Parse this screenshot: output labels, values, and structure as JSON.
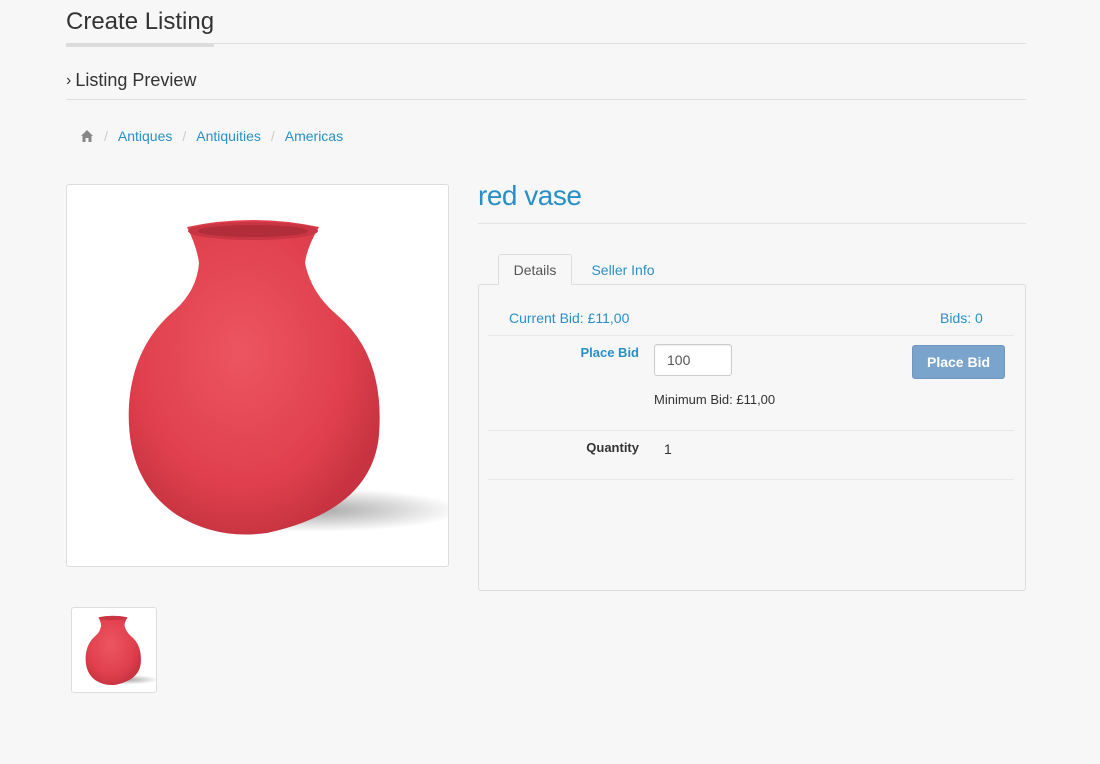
{
  "page": {
    "title": "Create Listing",
    "section_heading": "Listing Preview"
  },
  "breadcrumb": {
    "home_icon": "home-icon",
    "items": [
      "Antiques",
      "Antiquities",
      "Americas"
    ]
  },
  "listing": {
    "title": "red vase",
    "image_description": "red vase"
  },
  "tabs": [
    {
      "label": "Details",
      "active": true
    },
    {
      "label": "Seller Info",
      "active": false
    }
  ],
  "details": {
    "current_bid": "Current Bid: £11,00",
    "bids": "Bids: 0",
    "place_bid_label": "Place Bid",
    "bid_input_value": "100",
    "place_bid_button": "Place Bid",
    "minimum_bid": "Minimum Bid: £11,00",
    "quantity_label": "Quantity",
    "quantity_value": "1"
  },
  "colors": {
    "accent": "#2a8fc6",
    "button": "#7aa4cc",
    "vase": "#e0414e",
    "background": "#f7f7f7"
  }
}
